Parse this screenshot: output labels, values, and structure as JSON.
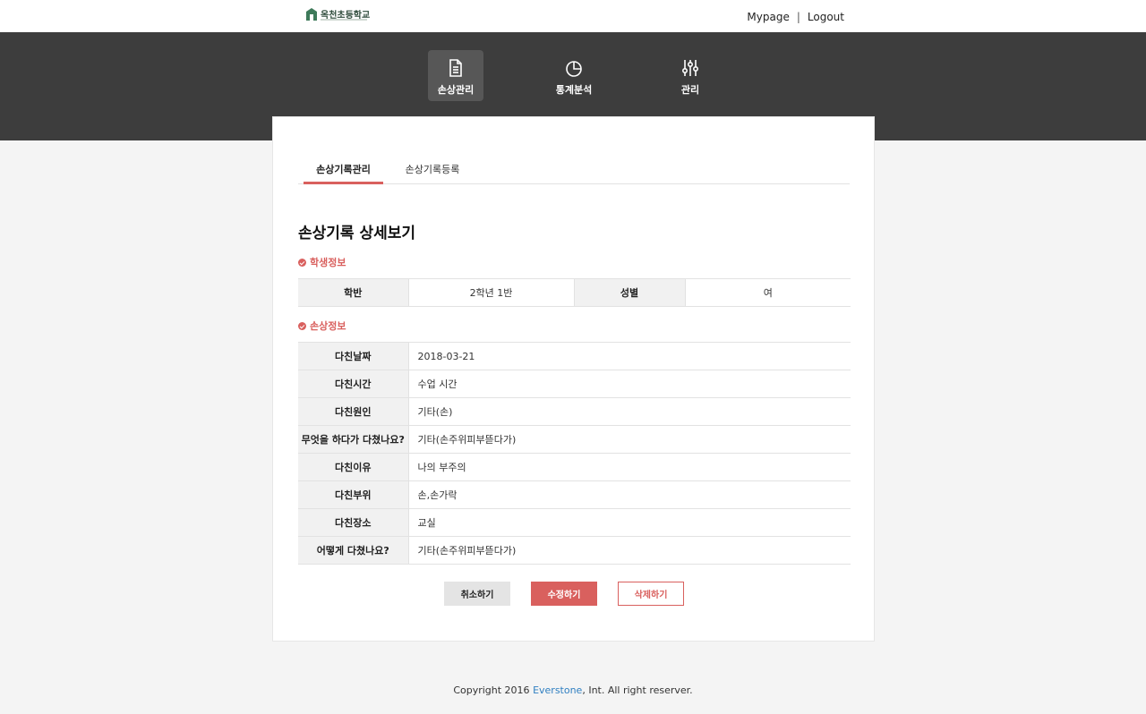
{
  "header": {
    "logo_text": "옥천초등학교",
    "mypage_label": "Mypage",
    "separator": "|",
    "logout_label": "Logout"
  },
  "nav": {
    "items": [
      {
        "label": "손상관리",
        "icon": "document-icon",
        "active": true
      },
      {
        "label": "통계분석",
        "icon": "pie-chart-icon",
        "active": false
      },
      {
        "label": "관리",
        "icon": "sliders-icon",
        "active": false
      }
    ]
  },
  "tabs": [
    {
      "label": "손상기록관리",
      "active": true
    },
    {
      "label": "손상기록등록",
      "active": false
    }
  ],
  "page_title": "손상기록 상세보기",
  "student_section": {
    "title": "학생정보",
    "class_label": "학반",
    "class_value": "2학년 1반",
    "gender_label": "성별",
    "gender_value": "여"
  },
  "injury_section": {
    "title": "손상정보",
    "rows": [
      {
        "label": "다친날짜",
        "value": "2018-03-21"
      },
      {
        "label": "다친시간",
        "value": "수업 시간"
      },
      {
        "label": "다친원인",
        "value": "기타(손)"
      },
      {
        "label": "무엇을 하다가 다쳤나요?",
        "value": "기타(손주위피부뜯다가)"
      },
      {
        "label": "다친이유",
        "value": "나의 부주의"
      },
      {
        "label": "다친부위",
        "value": "손,손가락"
      },
      {
        "label": "다친장소",
        "value": "교실"
      },
      {
        "label": "어떻게 다쳤나요?",
        "value": "기타(손주위피부뜯다가)"
      }
    ]
  },
  "buttons": {
    "cancel": "취소하기",
    "edit": "수정하기",
    "delete": "삭제하기"
  },
  "footer": {
    "prefix": "Copyright 2016 ",
    "brand": "Everstone",
    "suffix": ", Int. All right reserver."
  },
  "colors": {
    "accent": "#d9605e",
    "nav_band": "#3d3d3d",
    "link": "#2f7fc1"
  }
}
